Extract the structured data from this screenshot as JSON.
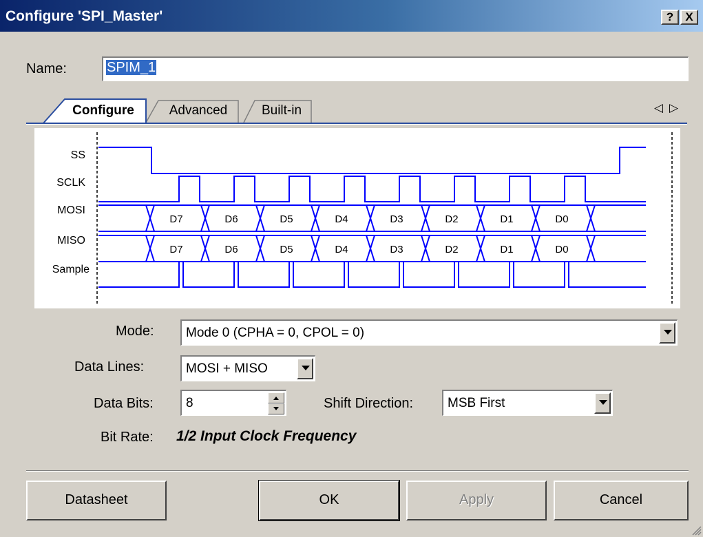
{
  "window": {
    "title": "Configure 'SPI_Master'",
    "help_label": "?",
    "close_label": "X"
  },
  "name_field": {
    "label": "Name:",
    "value": "SPIM_1"
  },
  "tabs": [
    {
      "label": "Configure",
      "active": true
    },
    {
      "label": "Advanced",
      "active": false
    },
    {
      "label": "Built-in",
      "active": false
    }
  ],
  "tab_nav": {
    "prev": "◁",
    "next": "▷"
  },
  "timing": {
    "signals": [
      "SS",
      "SCLK",
      "MOSI",
      "MISO",
      "Sample"
    ],
    "data_bits": [
      "D7",
      "D6",
      "D5",
      "D4",
      "D3",
      "D2",
      "D1",
      "D0"
    ]
  },
  "settings": {
    "mode": {
      "label": "Mode:",
      "value": "Mode 0 (CPHA = 0, CPOL = 0)"
    },
    "data_lines": {
      "label": "Data Lines:",
      "value": "MOSI + MISO"
    },
    "data_bits": {
      "label": "Data Bits:",
      "value": "8"
    },
    "shift_direction": {
      "label": "Shift Direction:",
      "value": "MSB First"
    },
    "bit_rate": {
      "label": "Bit Rate:",
      "value": "1/2 Input Clock Frequency"
    }
  },
  "buttons": {
    "datasheet": "Datasheet",
    "ok": "OK",
    "apply": "Apply",
    "cancel": "Cancel"
  },
  "colors": {
    "signal": "#0000ff",
    "title_start": "#0a246a",
    "face": "#d4d0c8",
    "selection": "#316ac5"
  }
}
